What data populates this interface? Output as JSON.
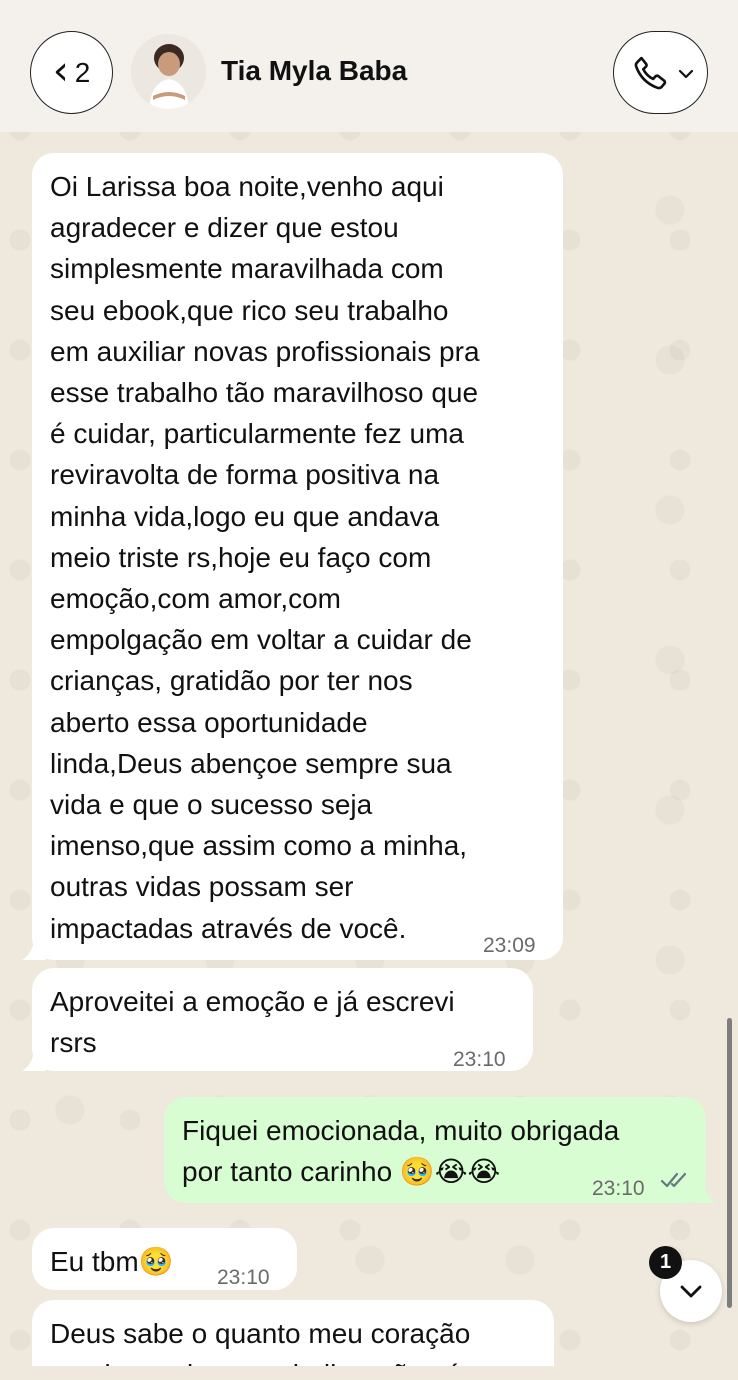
{
  "header": {
    "back_count": "2",
    "contact_name": "Tia Myla Baba"
  },
  "messages": [
    {
      "direction": "in",
      "text": "Oi Larissa boa noite,venho aqui\nagradecer e dizer que estou\nsimplesmente maravilhada com\nseu ebook,que rico seu trabalho\nem auxiliar novas profissionais pra\nesse trabalho tão maravilhoso que\né cuidar, particularmente fez uma\nreviravolta de forma positiva na\nminha vida,logo eu que andava\nmeio triste rs,hoje eu faço com\nemoção,com amor,com\nempolgação em voltar a cuidar de\ncrianças, gratidão por ter nos\naberto essa oportunidade\nlinda,Deus abençoe sempre sua\nvida e que o sucesso seja\nimenso,que assim como a minha,\noutras vidas possam ser\nimpactadas através de você.",
      "time": "23:09"
    },
    {
      "direction": "in",
      "text": "Aproveitei a emoção e já escrevi\nrsrs",
      "time": "23:10"
    },
    {
      "direction": "out",
      "text": "Fiquei emocionada, muito obrigada\npor tanto carinho 🥹😭😭",
      "time": "23:10",
      "status": "read"
    },
    {
      "direction": "in",
      "text": "Eu tbm🥹",
      "time": "23:10"
    },
    {
      "direction": "in",
      "text": "Deus sabe o quanto meu coração\nprecisava desse trabalho, não só",
      "time": ""
    }
  ],
  "unread_badge": "1",
  "icons": {
    "back": "chevron-left-icon",
    "call": "phone-icon",
    "call_menu": "chevron-down-icon",
    "read_status": "double-check-icon",
    "scroll_down": "chevron-down-icon"
  },
  "colors": {
    "incoming_bubble": "#ffffff",
    "outgoing_bubble": "#d9fdd3",
    "wallpaper": "#efe8dc",
    "read_ticks": "#667781"
  }
}
